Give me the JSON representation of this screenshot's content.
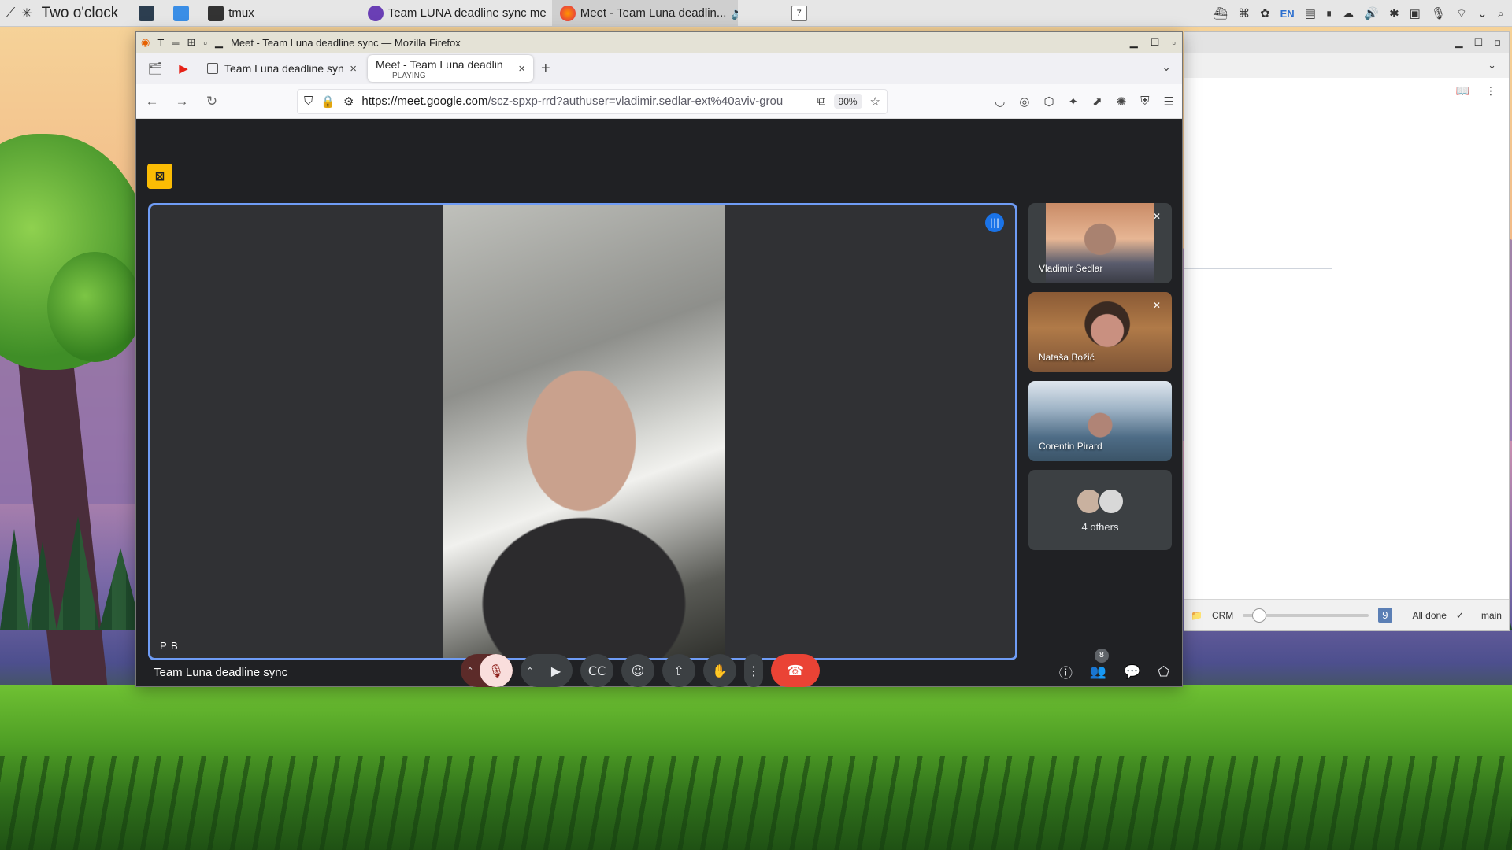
{
  "taskbar": {
    "clock": "Two o'clock",
    "apps": [
      {
        "label": "tmux",
        "icon": "terminal-icon"
      }
    ],
    "tasks": [
      {
        "label": "Team LUNA deadline sync me...",
        "icon": "chat-app-icon"
      },
      {
        "label": "Meet - Team Luna deadlin...",
        "icon": "firefox-icon",
        "active": true
      }
    ],
    "calendar_day": "7",
    "lang": "EN"
  },
  "firefox": {
    "window_title": "Meet - Team Luna deadline sync — Mozilla Firefox",
    "tabs": [
      {
        "label": "Team Luna deadline sync"
      },
      {
        "label": "Meet - Team Luna deadlin",
        "sub": "PLAYING",
        "selected": true
      }
    ],
    "url_domain": "https://meet.google.com",
    "url_rest": "/scz-spxp-rrd?authuser=vladimir.sedlar-ext%40aviv-grou",
    "zoom": "90%"
  },
  "meet": {
    "main_speaker": "P B",
    "meeting_title": "Team Luna deadline sync",
    "participants": [
      {
        "name": "Vladimir Sedlar",
        "muted": true
      },
      {
        "name": "Nataša Božić",
        "muted": true
      },
      {
        "name": "Corentin Pirard",
        "muted": false
      }
    ],
    "others_label": "4 others",
    "people_count": "8"
  },
  "bgwindow": {
    "status_project": "CRM",
    "status_badge": "9",
    "status_text": "All done",
    "branch": "main"
  },
  "colors": {
    "accent_blue": "#1a73e8",
    "leave_red": "#ea4335",
    "recording_yellow": "#fbbc04"
  }
}
